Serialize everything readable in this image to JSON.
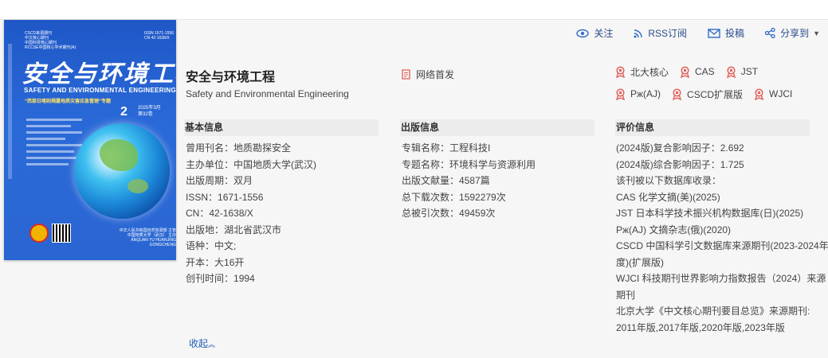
{
  "cover": {
    "top_left_text": [
      "CSCD来源期刊",
      "中文核心期刊",
      "中国科技核心期刊",
      "RCCSE中国核心学术期刊(A)"
    ],
    "top_right_text": [
      "ISSN 1671-1556",
      "CN 42-1638/X"
    ],
    "calligraphy_title": "安全与环境工程",
    "english_title": "SAFETY AND ENVIRONMENTAL ENGINEERING",
    "special_issue": "“西部日喀则揭露地质灾害应急管理”专题",
    "issue_number": "2",
    "issue_date": "2025年3月",
    "issue_volume": "第32卷",
    "publisher_lines": [
      "中华人民共和国自然资源部 主管",
      "中国地质大学（武汉） 主办",
      "ANQUAN YU HUANJING GONGCHENG"
    ]
  },
  "toolbar": {
    "follow": "关注",
    "rss": "RSS订阅",
    "submit": "投稿",
    "share": "分享到"
  },
  "journal": {
    "title": "安全与环境工程",
    "english_title": "Safety and Environmental Engineering",
    "net_first": "网络首发"
  },
  "badges": [
    "北大核心",
    "CAS",
    "JST",
    "Pж(AJ)",
    "CSCD扩展版",
    "WJCI"
  ],
  "basic": {
    "heading": "基本信息",
    "rows": [
      {
        "label": "曾用刊名：",
        "value": "地质勘探安全"
      },
      {
        "label": "主办单位：",
        "value": "中国地质大学(武汉)"
      },
      {
        "label": "出版周期：",
        "value": "双月"
      },
      {
        "label": "ISSN：",
        "value": "1671-1556"
      },
      {
        "label": "CN：",
        "value": "42-1638/X"
      },
      {
        "label": "出版地：",
        "value": "湖北省武汉市"
      },
      {
        "label": "语种：",
        "value": "中文;"
      },
      {
        "label": "开本：",
        "value": "大16开"
      },
      {
        "label": "创刊时间：",
        "value": "1994"
      }
    ]
  },
  "publish": {
    "heading": "出版信息",
    "rows": [
      {
        "label": "专辑名称：",
        "value": "工程科技I"
      },
      {
        "label": "专题名称：",
        "value": "环境科学与资源利用"
      },
      {
        "label": "出版文献量：",
        "value": "4587篇"
      },
      {
        "label": "总下载次数：",
        "value": "1592279次"
      },
      {
        "label": "总被引次数：",
        "value": "49459次"
      }
    ]
  },
  "evaluation": {
    "heading": "评价信息",
    "lines": [
      "(2024版)复合影响因子：2.692",
      "(2024版)综合影响因子：1.725",
      "该刊被以下数据库收录：",
      "CAS 化学文摘(美)(2025)",
      "JST 日本科学技术振兴机构数据库(日)(2025)",
      "Pж(AJ) 文摘杂志(俄)(2020)",
      "CSCD 中国科学引文数据库来源期刊(2023-2024年",
      "度)(扩展版)",
      "WJCI 科技期刊世界影响力指数报告（2024）来源",
      "期刊",
      "北京大学《中文核心期刊要目总览》来源期刊:",
      "2011年版,2017年版,2020年版,2023年版"
    ]
  },
  "collapse_label": "收起",
  "colors": {
    "link": "#1f5cb5",
    "badge": "#e0605a",
    "panel": "#f6f6f6",
    "header": "#ececec"
  }
}
